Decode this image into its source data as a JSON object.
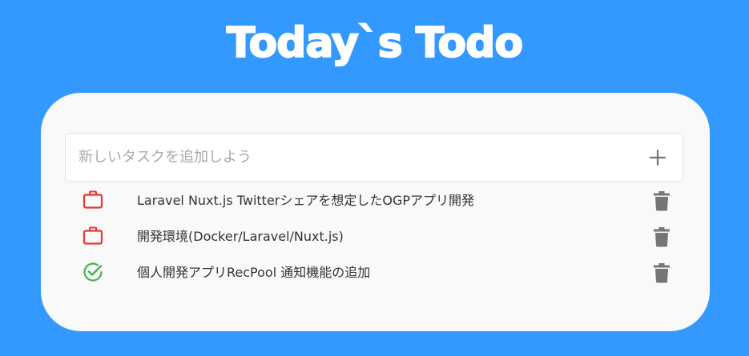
{
  "header": {
    "title": "Today`s Todo"
  },
  "new_task": {
    "placeholder": "新しいタスクを追加しよう",
    "value": "",
    "add_icon": "plus-icon"
  },
  "tasks": [
    {
      "label": "Laravel Nuxt.js Twitterシェアを想定したOGPアプリ開発",
      "status": "in-progress",
      "status_icon": "briefcase-icon",
      "delete_icon": "trash-icon"
    },
    {
      "label": "開発環境(Docker/Laravel/Nuxt.js)",
      "status": "in-progress",
      "status_icon": "briefcase-icon",
      "delete_icon": "trash-icon"
    },
    {
      "label": "個人開発アプリRecPool 通知機能の追加",
      "status": "done",
      "status_icon": "check-circle-icon",
      "delete_icon": "trash-icon"
    }
  ],
  "colors": {
    "background": "#3399ff",
    "card": "#f9f9f9",
    "in_progress": "#e53935",
    "done": "#4caf50",
    "icon_gray": "#757575"
  }
}
